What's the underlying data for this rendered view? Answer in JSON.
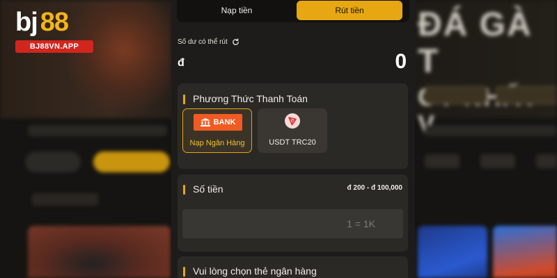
{
  "logo": {
    "brand_prefix": "bj",
    "brand_number": "88",
    "url": "BJ88VN.APP"
  },
  "tabs": {
    "deposit": "Nạp tiền",
    "withdraw": "Rút tiền",
    "active": "withdraw"
  },
  "balance": {
    "label": "Số dư có thể rút",
    "currency": "đ",
    "value": "0"
  },
  "payment_method": {
    "title": "Phương Thức Thanh Toán",
    "options": [
      {
        "label": "Nạp Ngân Hàng",
        "logo_text": "BANK",
        "icon": "bank-icon",
        "selected": true
      },
      {
        "label": "USDT TRC20",
        "icon": "tron-icon",
        "selected": false
      }
    ]
  },
  "amount": {
    "title": "Số tiền",
    "range": "đ 200 - đ 100,000",
    "placeholder": "1 = 1K",
    "value": ""
  },
  "bank_card": {
    "title": "Vui lòng chọn thẻ ngân hàng"
  },
  "colors": {
    "accent": "#e6a712",
    "panel_bg": "#1d1c1a",
    "card_bg": "#2b2926",
    "brand_red": "#d1261e",
    "bank_orange": "#f15a22",
    "tron_red": "#e0332e"
  }
}
